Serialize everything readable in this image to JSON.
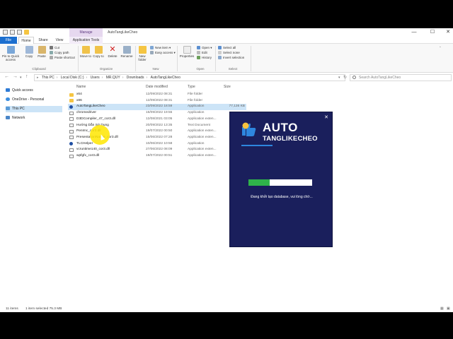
{
  "window": {
    "title": "AutoTangLikeCheo",
    "manage_tab": "Manage",
    "controls": [
      "—",
      "☐",
      "✕"
    ]
  },
  "ribbon": {
    "tabs": [
      "File",
      "Home",
      "Share",
      "View",
      "Application Tools"
    ],
    "clipboard": {
      "pin_label": "Pin to Quick access",
      "copy_label": "Copy",
      "paste_label": "Paste",
      "cut_label": "Cut",
      "copy_path_label": "Copy path",
      "paste_shortcut_label": "Paste shortcut",
      "group_label": "Clipboard"
    },
    "organize": {
      "move_label": "Move to",
      "copy_label": "Copy to",
      "delete_label": "Delete",
      "rename_label": "Rename",
      "group_label": "Organize"
    },
    "new": {
      "new_folder_label": "New folder",
      "new_item_label": "New item",
      "easy_access_label": "Easy access",
      "group_label": "New"
    },
    "open": {
      "properties_label": "Properties",
      "open_label": "Open",
      "edit_label": "Edit",
      "history_label": "History",
      "group_label": "Open"
    },
    "select": {
      "select_all_label": "Select all",
      "select_none_label": "Select none",
      "invert_label": "Invert selection",
      "group_label": "Select"
    }
  },
  "address": {
    "crumbs": [
      "This PC",
      "Local Disk (C:)",
      "Users",
      "MR.QUY",
      "Downloads",
      "AutoTangLikeCheo"
    ],
    "search_placeholder": "Search AutoTangLikeCheo"
  },
  "nav_pane": {
    "items": [
      "Quick access",
      "OneDrive - Personal",
      "This PC",
      "Network"
    ]
  },
  "file_list": {
    "headers": {
      "name": "Name",
      "date": "Date modified",
      "type": "Type",
      "size": "Size"
    },
    "rows": [
      {
        "name": "x64",
        "date": "12/09/2022 08:31",
        "type": "File folder",
        "size": "",
        "icon": "folder-icon"
      },
      {
        "name": "x86",
        "date": "12/09/2022 08:31",
        "type": "File folder",
        "size": "",
        "icon": "folder-icon"
      },
      {
        "name": "AutoTangLikeCheo",
        "date": "23/09/2022 18:59",
        "type": "Application",
        "size": "77,136 KB",
        "icon": "app-icon",
        "selected": true
      },
      {
        "name": "chromedriver",
        "date": "16/09/2022 19:55",
        "type": "Application",
        "size": "",
        "icon": "exe-icon"
      },
      {
        "name": "D3DCompiler_47_cor3.dll",
        "date": "12/08/2021 03:05",
        "type": "Application exten...",
        "size": "",
        "icon": "dll-icon"
      },
      {
        "name": "Hướng Dẫn Sử Dụng",
        "date": "20/09/2022 13:35",
        "type": "Text Document",
        "size": "",
        "icon": "doc-icon"
      },
      {
        "name": "PenImc_cor3.dll",
        "date": "19/07/2022 00:50",
        "type": "Application exten...",
        "size": "",
        "icon": "dll-icon"
      },
      {
        "name": "PresentationNative_cor3.dll",
        "date": "15/06/2022 07:28",
        "type": "Application exten...",
        "size": "",
        "icon": "dll-icon"
      },
      {
        "name": "TLCHelper",
        "date": "10/06/2022 10:58",
        "type": "Application",
        "size": "",
        "icon": "app-icon"
      },
      {
        "name": "vcruntime140_cor3.dll",
        "date": "27/06/2022 08:09",
        "type": "Application exten...",
        "size": "",
        "icon": "dll-icon"
      },
      {
        "name": "wpfgfx_cor3.dll",
        "date": "19/07/2022 00:51",
        "type": "Application exten...",
        "size": "",
        "icon": "dll-icon"
      }
    ]
  },
  "status_bar": {
    "item_count": "11 items",
    "selection": "1 item selected  75.3 MB"
  },
  "splash": {
    "logo_main": "AUTO",
    "logo_sub": "TANGLIKECHEO",
    "progress": 0.33,
    "status": "Đang khởi tạo database, vui lòng chờ...",
    "colors": {
      "background": "#1a1f5c",
      "progress_fill": "#2fb34a",
      "badge_blue": "#2e86de",
      "badge_yellow": "#f6c23e"
    }
  },
  "colors": {
    "file_tab": "#1c6fcf",
    "selection": "#cce4f7",
    "manage_tab": "#e6d8ef"
  }
}
